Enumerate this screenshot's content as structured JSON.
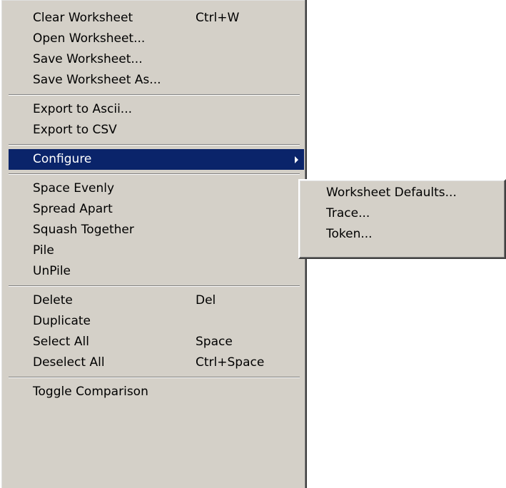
{
  "main_menu": {
    "groups": [
      [
        {
          "label": "Clear Worksheet",
          "shortcut": "Ctrl+W"
        },
        {
          "label": "Open Worksheet...",
          "shortcut": ""
        },
        {
          "label": "Save Worksheet...",
          "shortcut": ""
        },
        {
          "label": "Save Worksheet As...",
          "shortcut": ""
        }
      ],
      [
        {
          "label": "Export to Ascii...",
          "shortcut": ""
        },
        {
          "label": "Export to CSV",
          "shortcut": ""
        }
      ],
      [
        {
          "label": "Configure",
          "shortcut": "",
          "submenu": true,
          "active": true
        }
      ],
      [
        {
          "label": "Space Evenly",
          "shortcut": ""
        },
        {
          "label": "Spread Apart",
          "shortcut": ""
        },
        {
          "label": "Squash Together",
          "shortcut": ""
        },
        {
          "label": "Pile",
          "shortcut": ""
        },
        {
          "label": "UnPile",
          "shortcut": ""
        }
      ],
      [
        {
          "label": "Delete",
          "shortcut": "Del"
        },
        {
          "label": "Duplicate",
          "shortcut": ""
        },
        {
          "label": "Select All",
          "shortcut": "Space"
        },
        {
          "label": "Deselect All",
          "shortcut": "Ctrl+Space"
        }
      ],
      [
        {
          "label": "Toggle Comparison",
          "shortcut": ""
        }
      ]
    ]
  },
  "configure_submenu": {
    "items": [
      {
        "label": "Worksheet Defaults..."
      },
      {
        "label": "Trace..."
      },
      {
        "label": "Token..."
      }
    ]
  },
  "colors": {
    "menu_background": "#d4d0c8",
    "highlight": "#0a246a",
    "highlight_text": "#ffffff"
  }
}
